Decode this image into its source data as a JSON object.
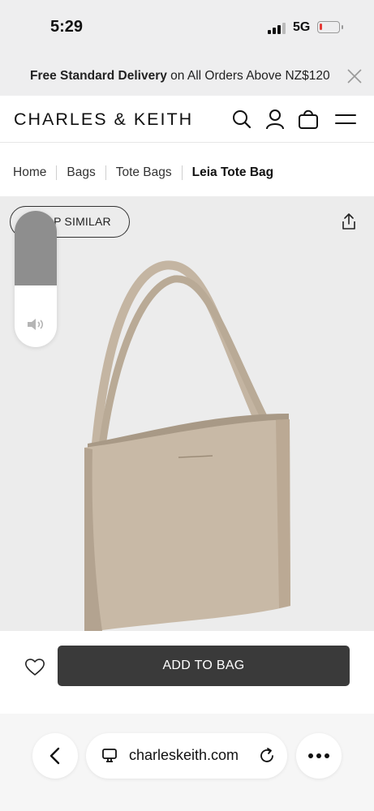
{
  "status_bar": {
    "time": "5:29",
    "network": "5G",
    "battery_level": 0.15,
    "battery_color": "#e53935"
  },
  "promo": {
    "bold": "Free Standard Delivery",
    "rest": " on All Orders Above NZ$120"
  },
  "header": {
    "logo": "CHARLES & KEITH",
    "icons": [
      "search-icon",
      "account-icon",
      "bag-icon",
      "menu-icon"
    ]
  },
  "breadcrumb": [
    {
      "label": "Home"
    },
    {
      "label": "Bags"
    },
    {
      "label": "Tote Bags"
    },
    {
      "label": "Leia Tote Bag"
    }
  ],
  "gallery": {
    "shop_similar": "SHOP SIMILAR",
    "share_icon": "share-icon",
    "background": "#ececec",
    "bag_color": "#c8b9a6"
  },
  "volume_hud": {
    "level": 0.55,
    "icon": "speaker-icon"
  },
  "actions": {
    "add_to_bag": "ADD TO BAG",
    "wishlist_icon": "heart-icon",
    "button_color": "#3a3a3a"
  },
  "browser": {
    "url": "charleskeith.com",
    "icons": [
      "back-icon",
      "reader-icon",
      "reload-icon",
      "more-icon"
    ]
  }
}
